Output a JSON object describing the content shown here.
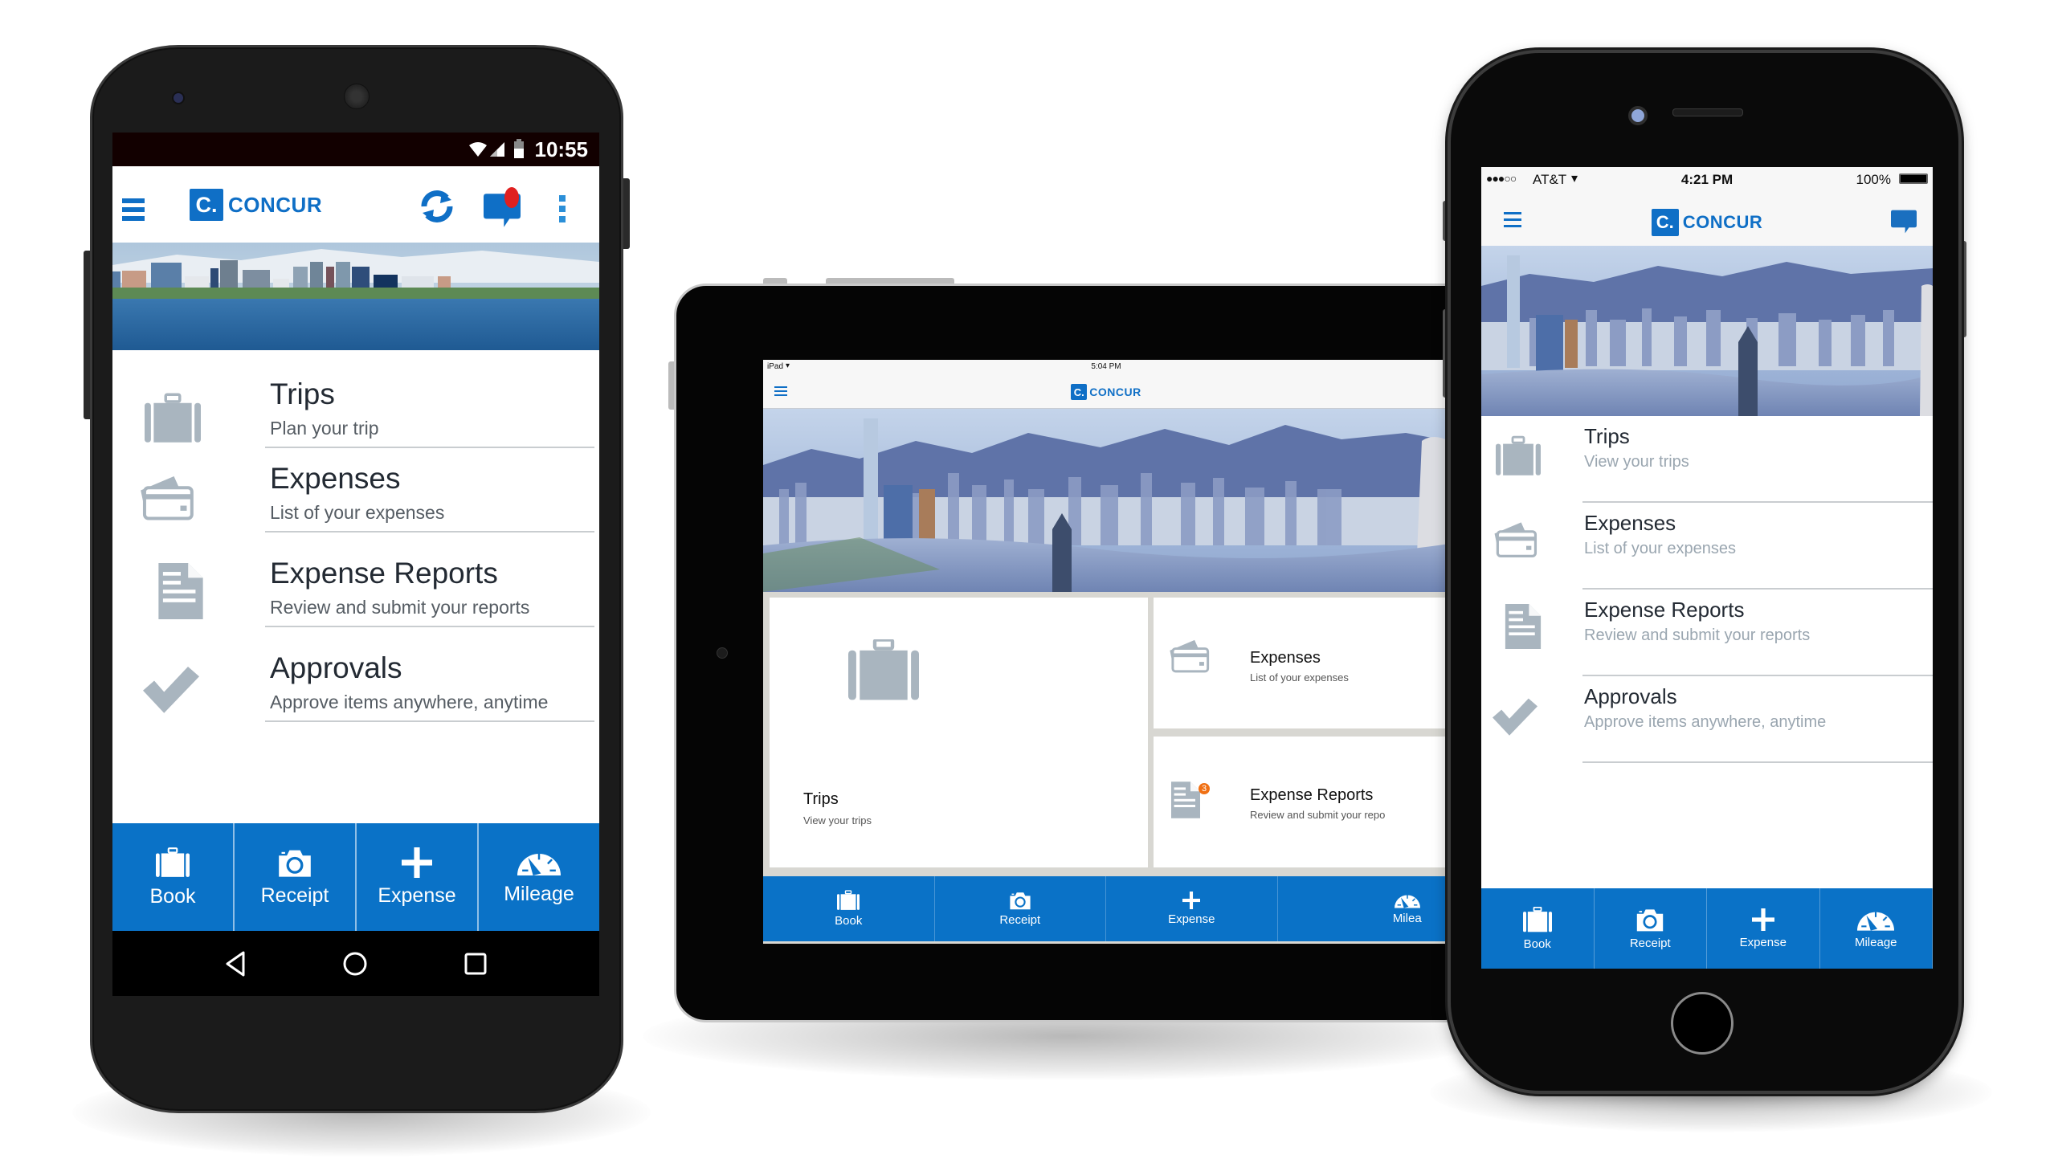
{
  "brand": {
    "name": "CONCUR",
    "mark": "C.",
    "accent_color": "#0f6fc6",
    "nav_color": "#0a72c7",
    "icon_gray": "#a9b5bf",
    "badge_color": "#f07014",
    "notification_color": "#e02020"
  },
  "android": {
    "status_bar": {
      "icons": [
        "wifi-icon",
        "signal-icon",
        "battery-icon"
      ],
      "time": "10:55"
    },
    "header": {
      "menu_icon": "hamburger-menu-icon",
      "logo_text": "CONCUR",
      "actions": [
        "sync-icon",
        "messages-icon",
        "overflow-menu-icon"
      ],
      "has_notification_dot": true
    },
    "menu_items": [
      {
        "title": "Trips",
        "subtitle": "Plan your trip",
        "icon": "suitcase-icon"
      },
      {
        "title": "Expenses",
        "subtitle": "List of your expenses",
        "icon": "credit-card-icon"
      },
      {
        "title": "Expense Reports",
        "subtitle": "Review and submit your reports",
        "icon": "document-icon"
      },
      {
        "title": "Approvals",
        "subtitle": "Approve items anywhere, anytime",
        "icon": "checkmark-icon"
      }
    ],
    "bottom_nav": [
      {
        "label": "Book",
        "icon": "suitcase-icon"
      },
      {
        "label": "Receipt",
        "icon": "camera-icon"
      },
      {
        "label": "Expense",
        "icon": "plus-icon"
      },
      {
        "label": "Mileage",
        "icon": "speedometer-icon"
      }
    ],
    "system_nav": [
      "back-icon",
      "home-icon",
      "recents-icon"
    ]
  },
  "tablet": {
    "status_bar": {
      "carrier": "iPad",
      "time": "5:04 PM"
    },
    "header": {
      "logo_text": "CONCUR"
    },
    "tiles": [
      {
        "title": "Trips",
        "subtitle": "View your trips",
        "icon": "suitcase-icon"
      },
      {
        "title": "Expenses",
        "subtitle": "List of your expenses",
        "icon": "credit-card-icon"
      },
      {
        "title": "Expense Reports",
        "subtitle": "Review and submit your repo",
        "icon": "document-icon",
        "badge": "3"
      }
    ],
    "bottom_nav": [
      {
        "label": "Book",
        "icon": "suitcase-icon"
      },
      {
        "label": "Receipt",
        "icon": "camera-icon"
      },
      {
        "label": "Expense",
        "icon": "plus-icon"
      },
      {
        "label": "Milea",
        "icon": "speedometer-icon"
      }
    ]
  },
  "iphone": {
    "status_bar": {
      "signal": "●●●○○",
      "carrier": "AT&T",
      "time": "4:21 PM",
      "battery": "100%"
    },
    "header": {
      "logo_text": "CONCUR",
      "actions": [
        "messages-icon"
      ]
    },
    "menu_items": [
      {
        "title": "Trips",
        "subtitle": "View your trips",
        "icon": "suitcase-icon"
      },
      {
        "title": "Expenses",
        "subtitle": "List of your expenses",
        "icon": "credit-card-icon"
      },
      {
        "title": "Expense Reports",
        "subtitle": "Review and submit your reports",
        "icon": "document-icon"
      },
      {
        "title": "Approvals",
        "subtitle": "Approve items anywhere, anytime",
        "icon": "checkmark-icon"
      }
    ],
    "bottom_nav": [
      {
        "label": "Book",
        "icon": "suitcase-icon"
      },
      {
        "label": "Receipt",
        "icon": "camera-icon"
      },
      {
        "label": "Expense",
        "icon": "plus-icon"
      },
      {
        "label": "Mileage",
        "icon": "speedometer-icon"
      }
    ]
  }
}
